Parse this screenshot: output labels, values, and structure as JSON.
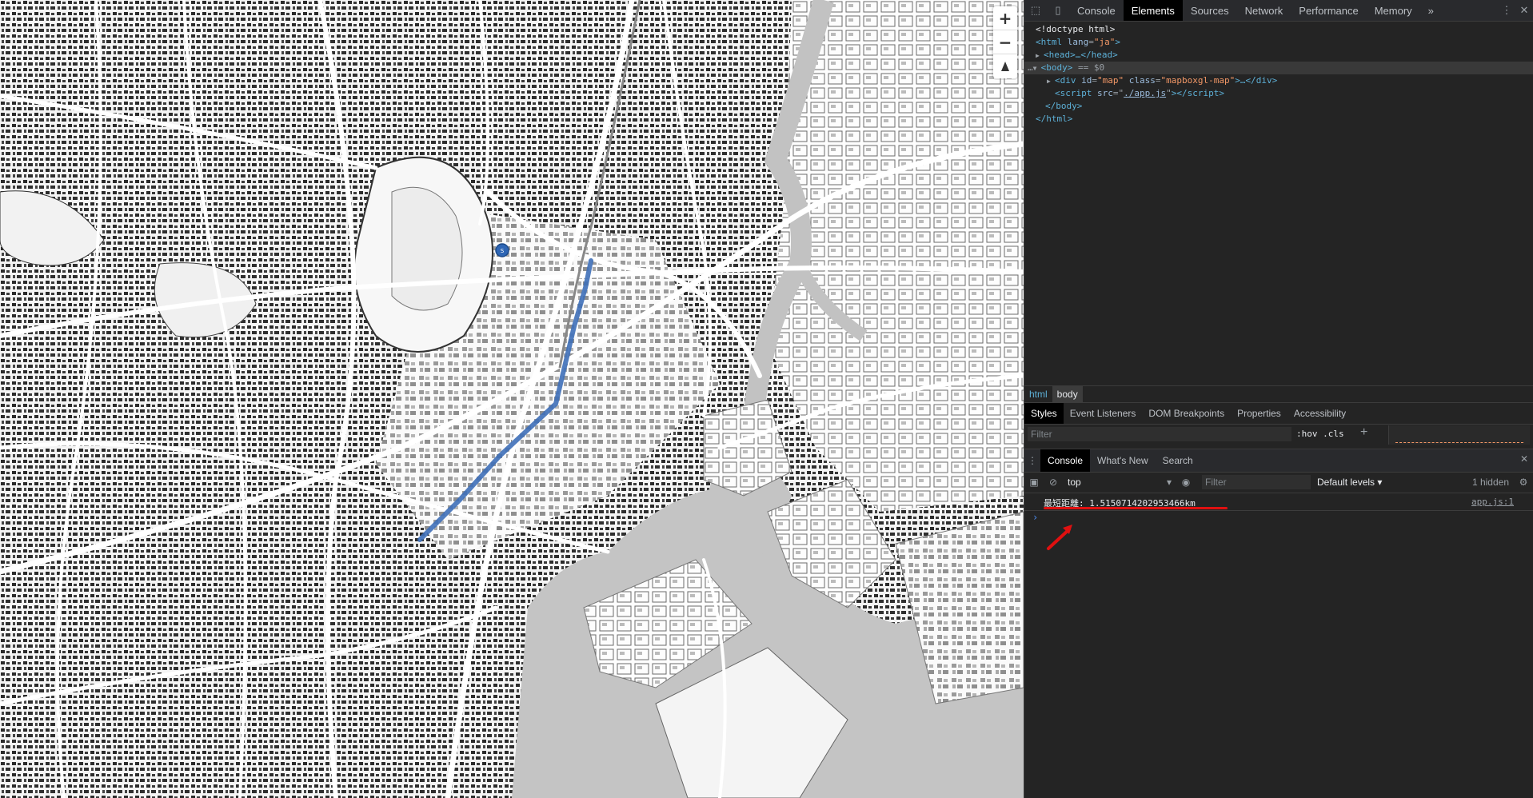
{
  "map": {
    "zoom_in_label": "+",
    "zoom_out_label": "−",
    "route_color": "#3e6fb8",
    "marker_label": "S"
  },
  "devtools": {
    "tabs": [
      "Console",
      "Elements",
      "Sources",
      "Network",
      "Performance",
      "Memory"
    ],
    "active_tab": "Elements",
    "more_tabs": "»",
    "elements": {
      "doctype": "<!doctype html>",
      "html_open_tag": "html",
      "html_lang_attr": "lang",
      "html_lang_val": "\"ja\"",
      "head": "<head>…</head>",
      "body_tag": "<body>",
      "body_eq": "== $0",
      "div_id_attr": "id",
      "div_id_val": "\"map\"",
      "div_class_attr": "class",
      "div_class_val": "\"mapboxgl-map\"",
      "div_close": ">…</div>",
      "script_src_attr": "src",
      "script_src_val": "./app.js",
      "body_close": "</body>",
      "html_close": "</html>"
    },
    "breadcrumbs": [
      "html",
      "body"
    ],
    "style_tabs": [
      "Styles",
      "Event Listeners",
      "DOM Breakpoints",
      "Properties",
      "Accessibility"
    ],
    "style_filter_placeholder": "Filter",
    "hov_cls": ":hov  .cls",
    "drawer_tabs": [
      "Console",
      "What's New",
      "Search"
    ],
    "console": {
      "context": "top",
      "filter_placeholder": "Filter",
      "levels": "Default levels ▾",
      "hidden": "1 hidden",
      "message": "最短距離: 1.5150714202953466km",
      "source": "app.js:1",
      "prompt": "›"
    }
  }
}
